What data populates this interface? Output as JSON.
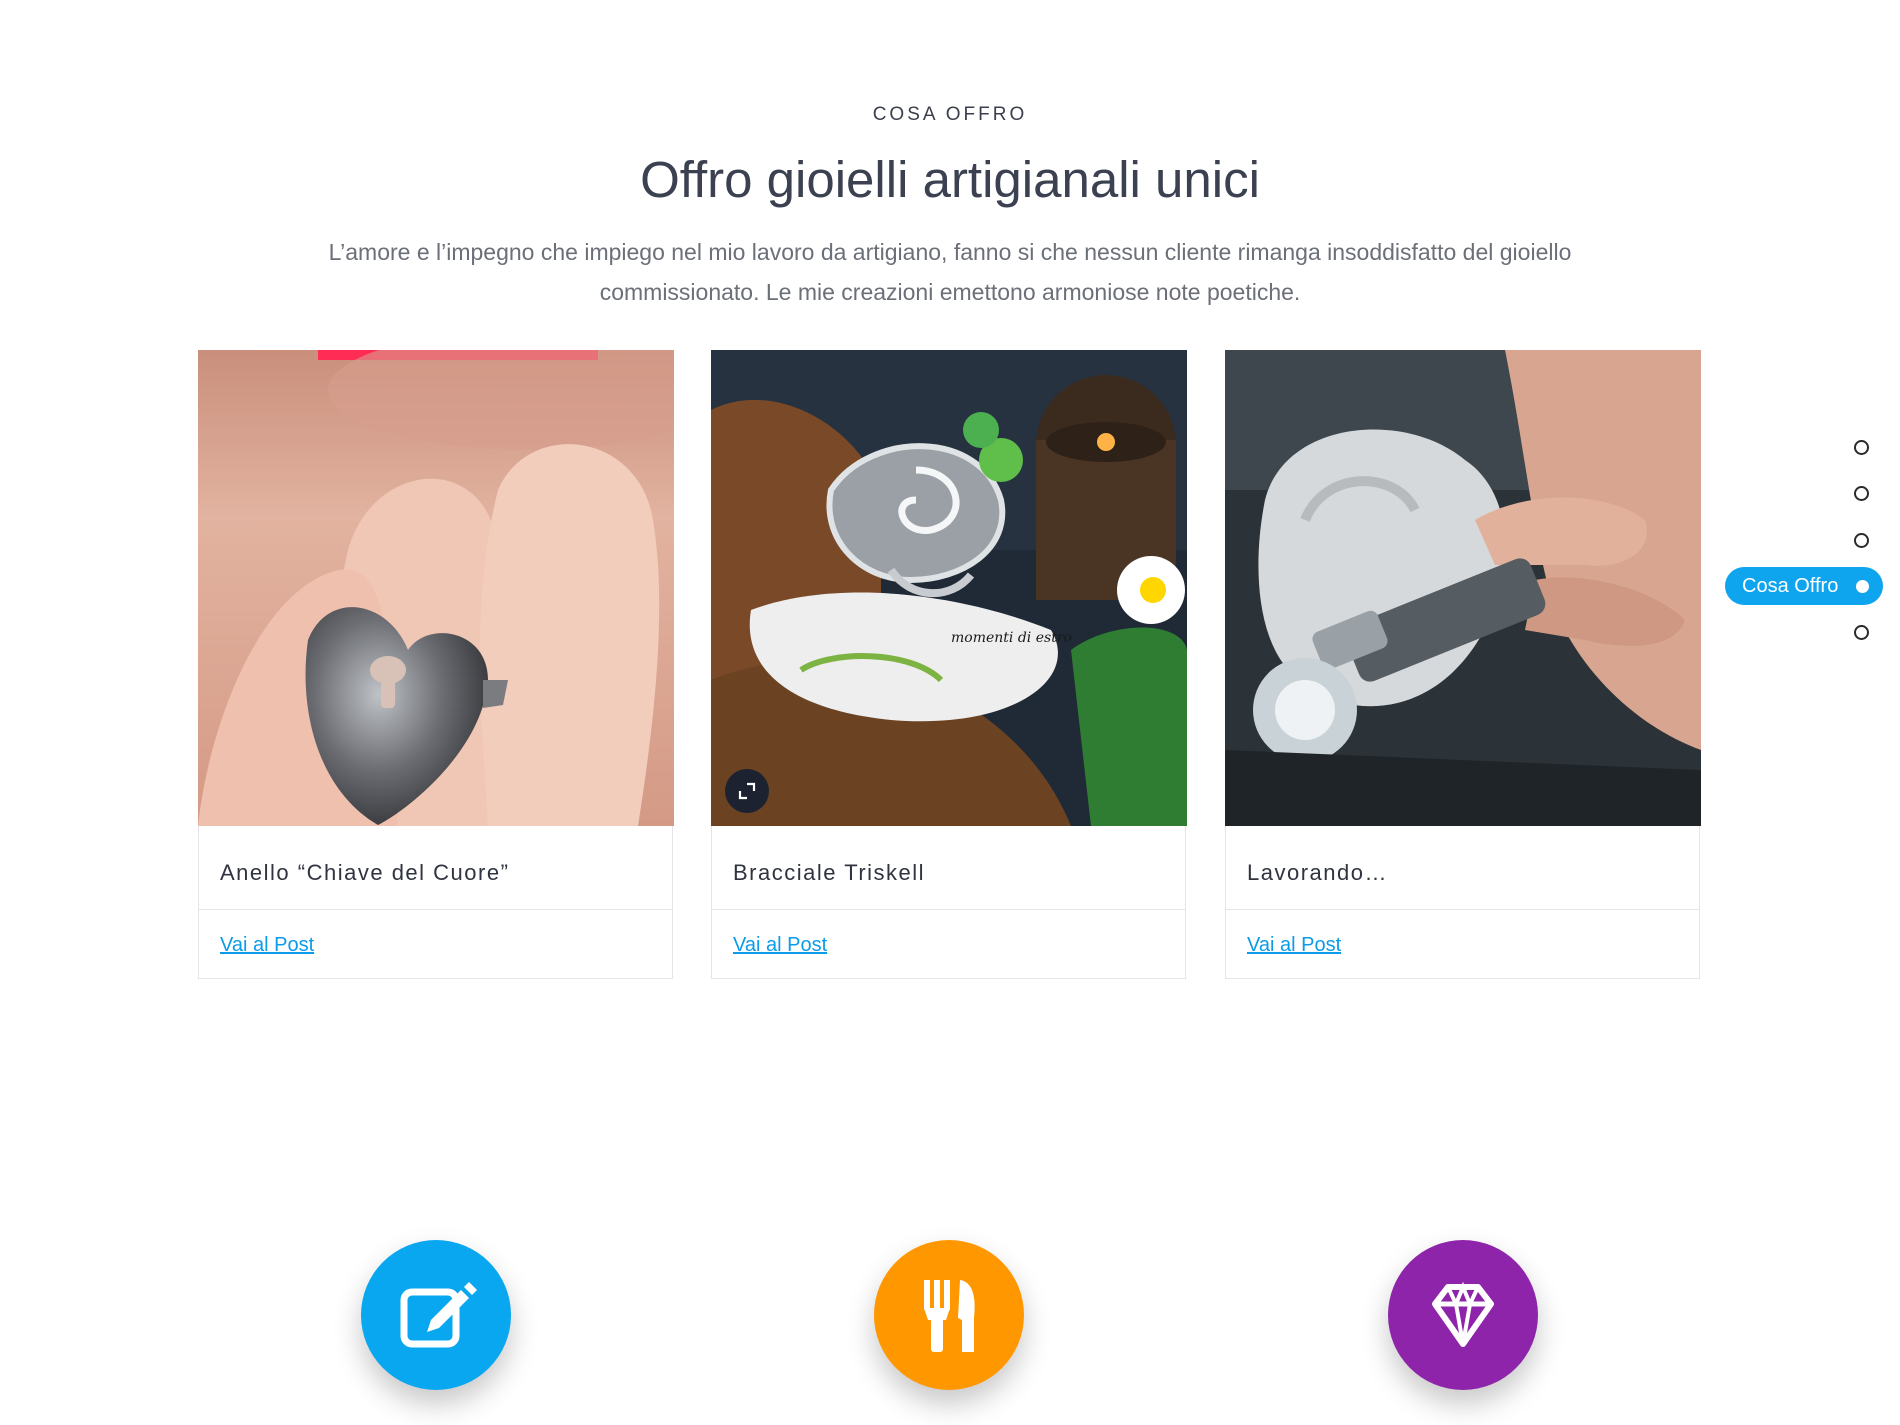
{
  "section": {
    "eyebrow": "COSA OFFRO",
    "title": "Offro gioielli artigianali unici",
    "lead": "L’amore e l’impegno che impiego nel mio lavoro da artigiano, fanno si che nessun cliente rimanga insoddisfatto del gioiello commissionato. Le mie creazioni emettono armoniose note poetiche."
  },
  "cards": [
    {
      "title": "Anello “Chiave del Cuore”",
      "link": "Vai al Post"
    },
    {
      "title": "Bracciale Triskell",
      "link": "Vai al Post",
      "watermark": "momenti di estro"
    },
    {
      "title": "Lavorando…",
      "link": "Vai al Post"
    }
  ],
  "dot_nav": {
    "active_label": "Cosa Offro",
    "active_color": "#0ea5ee"
  },
  "features": [
    {
      "icon": "pencil-edit-icon",
      "color": "#0aa7f1"
    },
    {
      "icon": "fork-knife-icon",
      "color": "#ff9800"
    },
    {
      "icon": "diamond-icon",
      "color": "#8e24aa"
    }
  ],
  "colors": {
    "link": "#0b9be9",
    "heading": "#3b4150",
    "body_text": "#6b6f78"
  }
}
